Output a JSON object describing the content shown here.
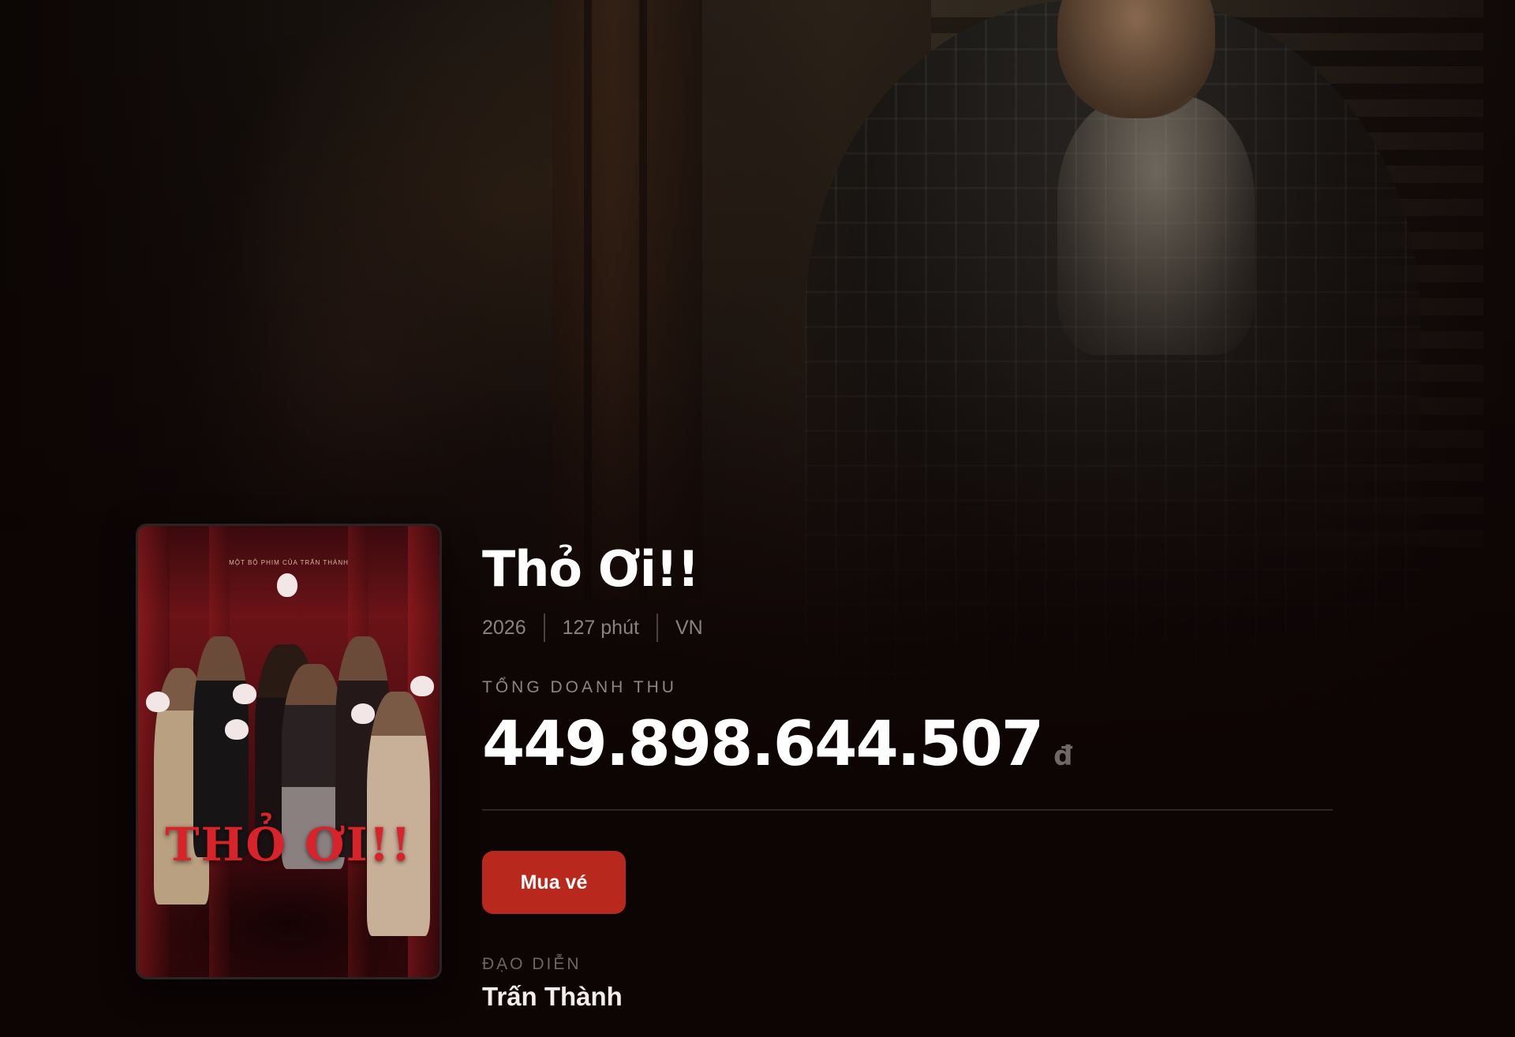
{
  "movie": {
    "title": "Thỏ Ơi!!",
    "year": "2026",
    "duration": "127 phút",
    "country": "VN"
  },
  "revenue": {
    "label": "TỔNG DOANH THU",
    "amount": "449.898.644.507",
    "unit": "đ"
  },
  "actions": {
    "buy_ticket_label": "Mua vé"
  },
  "director": {
    "label": "ĐẠO DIỄN",
    "name": "Trấn Thành"
  },
  "poster": {
    "title_text": "THỎ ƠI!!",
    "tagline": "MỘT BỘ PHIM CỦA TRẤN THÀNH"
  },
  "colors": {
    "accent": "#b9281d",
    "background": "#0d0404",
    "muted_text": "#8a8181"
  }
}
